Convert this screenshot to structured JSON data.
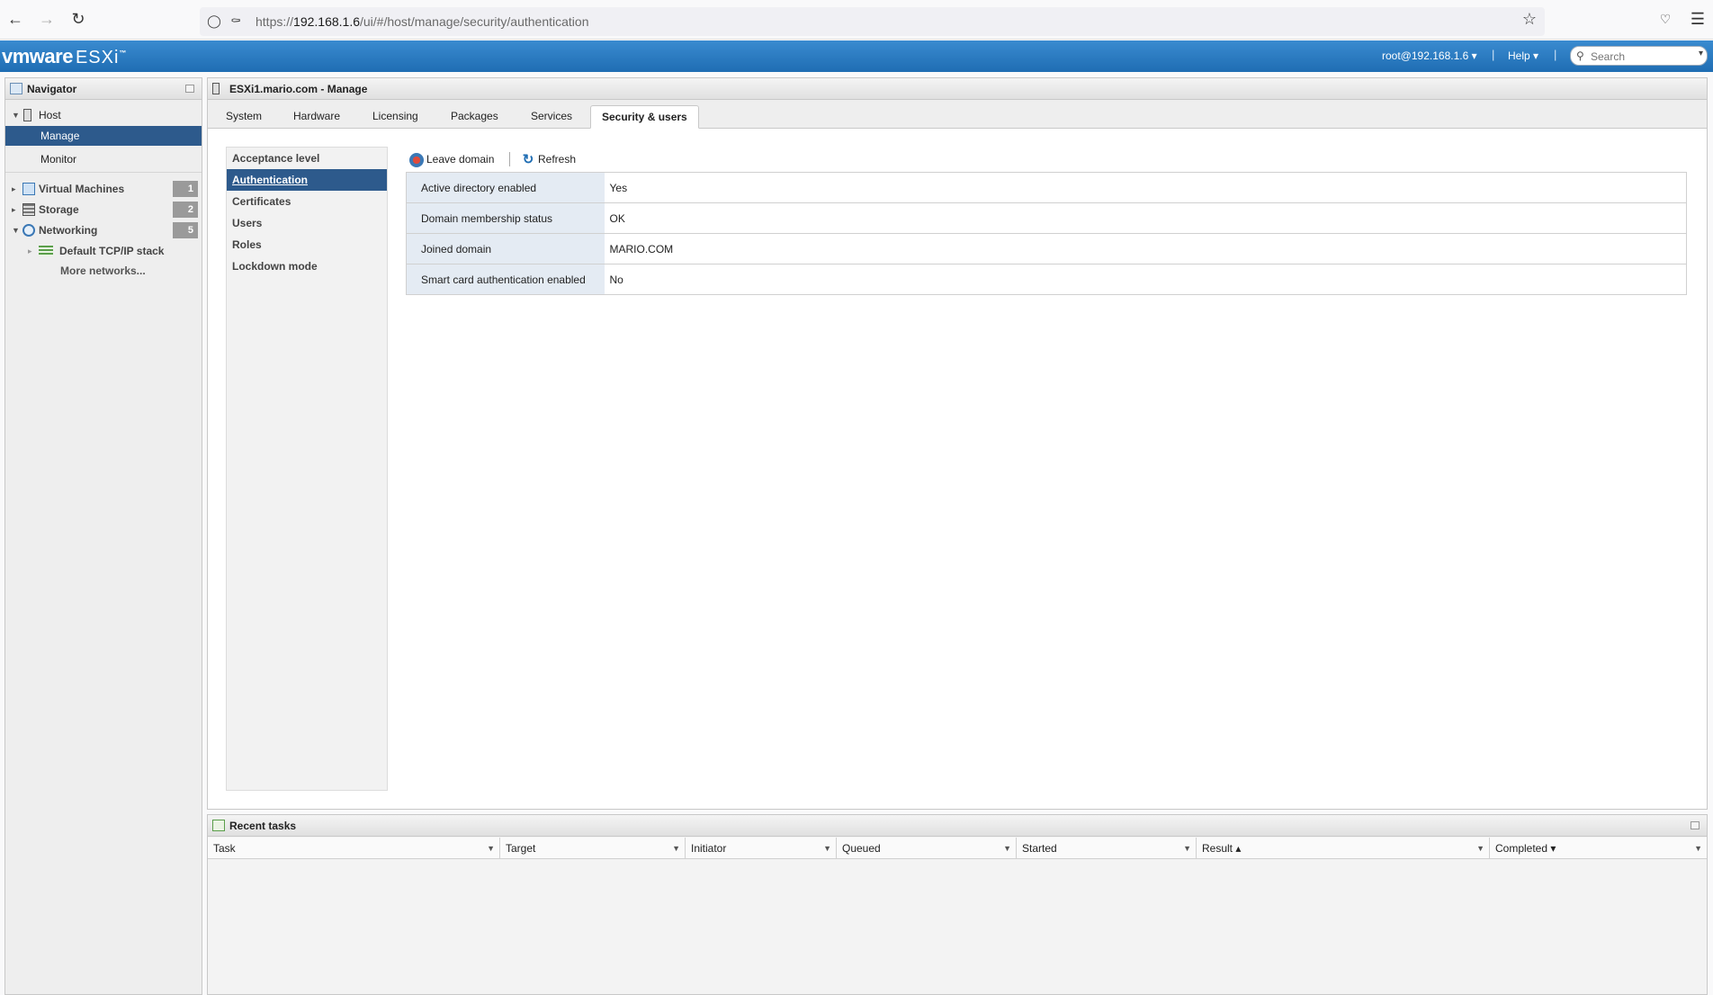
{
  "browser": {
    "url_prefix": "https://",
    "url_host": "192.168.1.6",
    "url_path": "/ui/#/host/manage/security/authentication"
  },
  "header": {
    "brand": "vmware",
    "product": "ESXi",
    "tm": "™",
    "user": "root@192.168.1.6",
    "help": "Help",
    "search_placeholder": "Search"
  },
  "navigator": {
    "title": "Navigator",
    "host": "Host",
    "manage": "Manage",
    "monitor": "Monitor",
    "virtual_machines": "Virtual Machines",
    "virtual_machines_count": "1",
    "storage": "Storage",
    "storage_count": "2",
    "networking": "Networking",
    "networking_count": "5",
    "tcpip_stack": "Default TCP/IP stack",
    "more_networks": "More networks..."
  },
  "main": {
    "title": "ESXi1.mario.com - Manage",
    "tabs": [
      "System",
      "Hardware",
      "Licensing",
      "Packages",
      "Services",
      "Security & users"
    ],
    "sub_nav": [
      "Acceptance level",
      "Authentication",
      "Certificates",
      "Users",
      "Roles",
      "Lockdown mode"
    ],
    "toolbar": {
      "leave_domain": "Leave domain",
      "refresh": "Refresh"
    },
    "properties": [
      {
        "key": "Active directory enabled",
        "value": "Yes"
      },
      {
        "key": "Domain membership status",
        "value": "OK"
      },
      {
        "key": "Joined domain",
        "value": "MARIO.COM"
      },
      {
        "key": "Smart card authentication enabled",
        "value": "No"
      }
    ]
  },
  "tasks": {
    "title": "Recent tasks",
    "columns": [
      "Task",
      "Target",
      "Initiator",
      "Queued",
      "Started",
      "Result ▴",
      "Completed ▾"
    ]
  }
}
